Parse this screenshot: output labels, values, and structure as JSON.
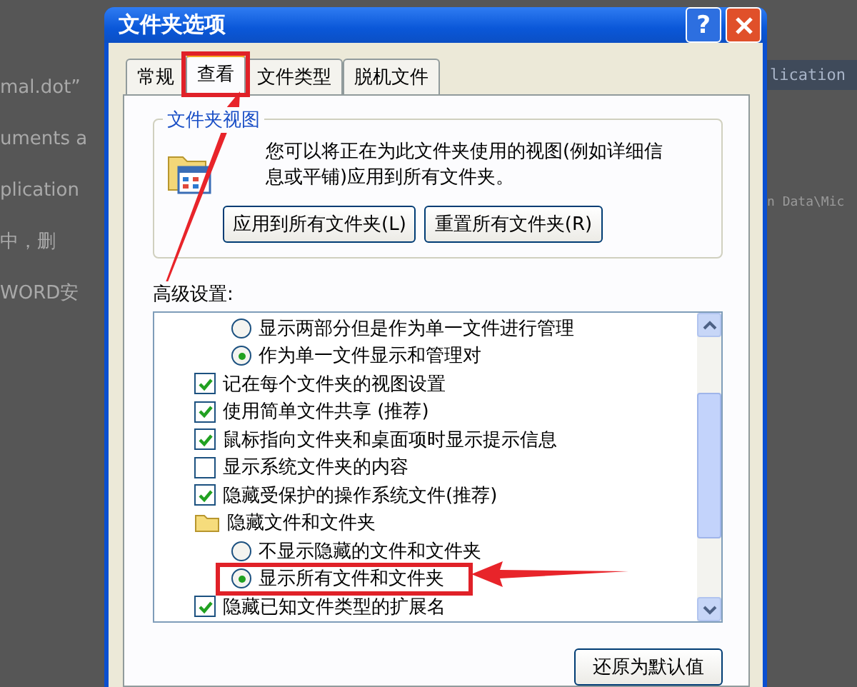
{
  "background": {
    "left_texts": [
      "mal.dot”",
      "uments a",
      "plication",
      "中，删",
      "WORD安"
    ],
    "right_texts": [
      "lication",
      "n Data\\Mic"
    ]
  },
  "window": {
    "title": "文件夹选项",
    "help": "?"
  },
  "tabs": [
    {
      "label": "常规",
      "selected": false,
      "highlighted": false
    },
    {
      "label": "查看",
      "selected": true,
      "highlighted": true
    },
    {
      "label": "文件类型",
      "selected": false,
      "highlighted": false
    },
    {
      "label": "脱机文件",
      "selected": false,
      "highlighted": false
    }
  ],
  "folder_views": {
    "title": "文件夹视图",
    "description": "您可以将正在为此文件夹使用的视图(例如详细信息或平铺)应用到所有文件夹。",
    "buttons": [
      "应用到所有文件夹(L)",
      "重置所有文件夹(R)"
    ]
  },
  "advanced": {
    "label": "高级设置:",
    "items": [
      {
        "kind": "group",
        "children": [
          {
            "kind": "radio",
            "label": "显示两部分但是作为单一文件进行管理",
            "checked": false,
            "highlighted": false
          },
          {
            "kind": "radio",
            "label": "作为单一文件显示和管理对",
            "checked": true,
            "highlighted": false
          }
        ]
      },
      {
        "kind": "checkbox",
        "label": "记在每个文件夹的视图设置",
        "checked": true
      },
      {
        "kind": "checkbox",
        "label": "使用简单文件共享 (推荐)",
        "checked": true
      },
      {
        "kind": "checkbox",
        "label": "鼠标指向文件夹和桌面项时显示提示信息",
        "checked": true
      },
      {
        "kind": "checkbox",
        "label": "显示系统文件夹的内容",
        "checked": false
      },
      {
        "kind": "checkbox",
        "label": "隐藏受保护的操作系统文件(推荐)",
        "checked": true
      },
      {
        "kind": "folder",
        "label": "隐藏文件和文件夹",
        "children": [
          {
            "kind": "radio",
            "label": "不显示隐藏的文件和文件夹",
            "checked": false,
            "highlighted": false
          },
          {
            "kind": "radio",
            "label": "显示所有文件和文件夹",
            "checked": true,
            "highlighted": true
          }
        ]
      },
      {
        "kind": "checkbox",
        "label": "隐藏已知文件类型的扩展名",
        "checked": true
      }
    ]
  },
  "restore_button": "还原为默认值"
}
